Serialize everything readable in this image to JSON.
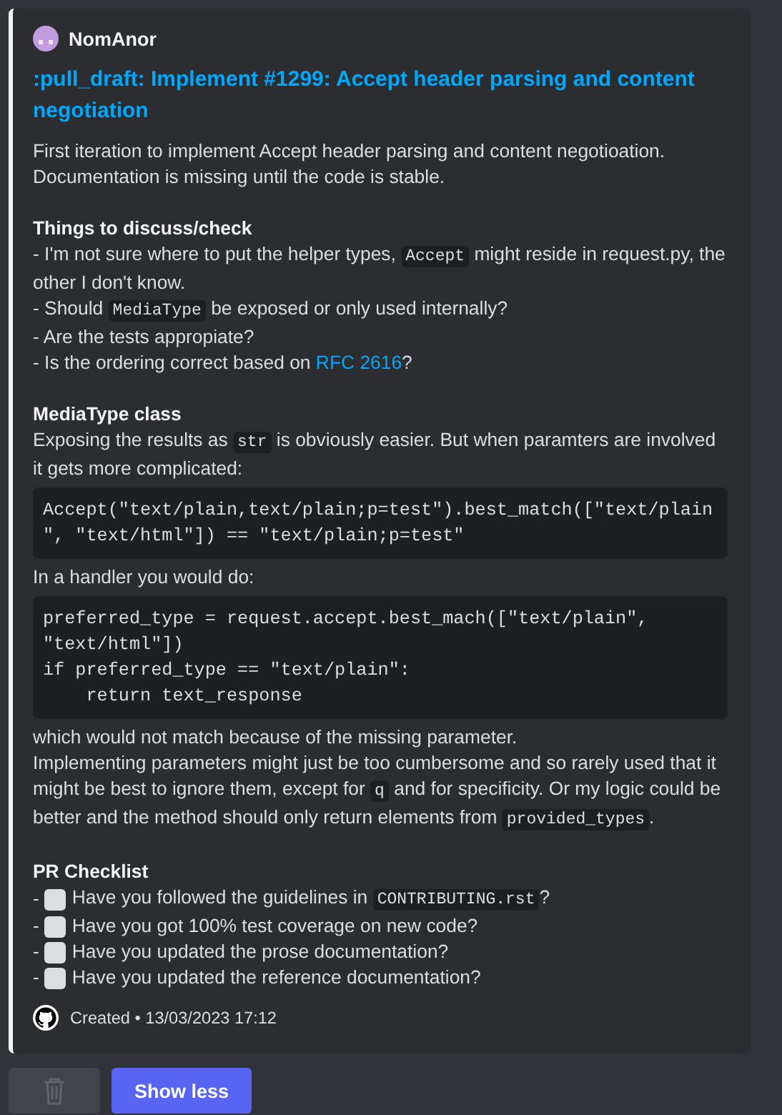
{
  "author": {
    "name": "NomAnor"
  },
  "title": ":pull_draft: Implement #1299: Accept header parsing and content negotiation",
  "blocks": [
    {
      "kind": "line",
      "segments": [
        {
          "kind": "text",
          "text": "First iteration to implement Accept header parsing and content negotioation."
        }
      ]
    },
    {
      "kind": "line",
      "segments": [
        {
          "kind": "text",
          "text": "Documentation is missing until the code is stable."
        }
      ]
    },
    {
      "kind": "blank"
    },
    {
      "kind": "heading",
      "text": "Things to discuss/check"
    },
    {
      "kind": "line",
      "segments": [
        {
          "kind": "text",
          "text": "- I'm not sure where to put the helper types, "
        },
        {
          "kind": "code",
          "text": "Accept"
        },
        {
          "kind": "text",
          "text": " might reside in request.py, the other I don't know."
        }
      ]
    },
    {
      "kind": "line",
      "segments": [
        {
          "kind": "text",
          "text": "- Should "
        },
        {
          "kind": "code",
          "text": "MediaType"
        },
        {
          "kind": "text",
          "text": " be exposed or only used internally?"
        }
      ]
    },
    {
      "kind": "line",
      "segments": [
        {
          "kind": "text",
          "text": "- Are the tests appropiate?"
        }
      ]
    },
    {
      "kind": "line",
      "segments": [
        {
          "kind": "text",
          "text": "- Is the ordering correct based on "
        },
        {
          "kind": "link",
          "text": "RFC 2616"
        },
        {
          "kind": "text",
          "text": "?"
        }
      ]
    },
    {
      "kind": "blank"
    },
    {
      "kind": "heading",
      "text": "MediaType class"
    },
    {
      "kind": "line",
      "segments": [
        {
          "kind": "text",
          "text": "Exposing the results as "
        },
        {
          "kind": "code",
          "text": "str"
        },
        {
          "kind": "text",
          "text": " is obviously easier. But when paramters are involved it gets more complicated:"
        }
      ]
    },
    {
      "kind": "code_block",
      "text": "Accept(\"text/plain,text/plain;p=test\").best_match([\"text/plain\", \"text/html\"]) == \"text/plain;p=test\""
    },
    {
      "kind": "line",
      "segments": [
        {
          "kind": "text",
          "text": "In a handler you would do:"
        }
      ]
    },
    {
      "kind": "code_block",
      "text": "preferred_type = request.accept.best_mach([\"text/plain\", \"text/html\"])\nif preferred_type == \"text/plain\":\n    return text_response"
    },
    {
      "kind": "line",
      "segments": [
        {
          "kind": "text",
          "text": "which would not match because of the missing parameter."
        }
      ]
    },
    {
      "kind": "line",
      "segments": [
        {
          "kind": "text",
          "text": "Implementing parameters might just be too cumbersome and so rarely used that it might be best to ignore them, except for "
        },
        {
          "kind": "code",
          "text": "q"
        },
        {
          "kind": "text",
          "text": " and for specificity. Or my logic could be better and the method should only return elements from "
        },
        {
          "kind": "code",
          "text": "provided_types"
        },
        {
          "kind": "text",
          "text": "."
        }
      ]
    },
    {
      "kind": "blank"
    },
    {
      "kind": "heading",
      "text": "PR Checklist"
    },
    {
      "kind": "check",
      "marker": "-",
      "checked": false,
      "segments": [
        {
          "kind": "text",
          "text": "Have you followed the guidelines in "
        },
        {
          "kind": "code",
          "text": "CONTRIBUTING.rst"
        },
        {
          "kind": "text",
          "text": "?"
        }
      ]
    },
    {
      "kind": "check",
      "marker": "-",
      "checked": false,
      "segments": [
        {
          "kind": "text",
          "text": "Have you got 100% test coverage on new code?"
        }
      ]
    },
    {
      "kind": "check",
      "marker": "-",
      "checked": false,
      "segments": [
        {
          "kind": "text",
          "text": "Have you updated the prose documentation?"
        }
      ]
    },
    {
      "kind": "check",
      "marker": "-",
      "checked": false,
      "segments": [
        {
          "kind": "text",
          "text": "Have you updated the reference documentation?"
        }
      ]
    }
  ],
  "footer": {
    "text": "Created • 13/03/2023 17:12"
  },
  "actions": [
    {
      "kind": "delete",
      "disabled": true
    },
    {
      "kind": "text",
      "label": "Show less",
      "disabled": false
    }
  ]
}
